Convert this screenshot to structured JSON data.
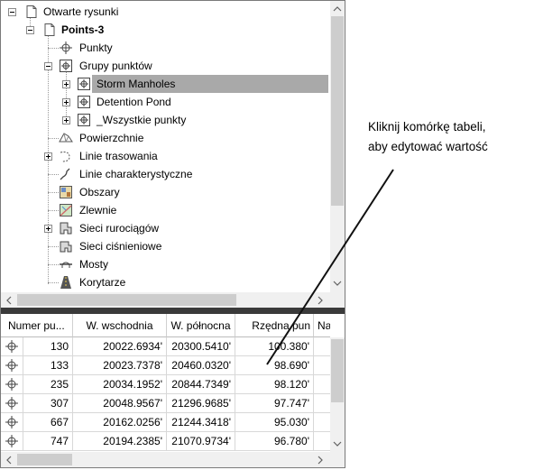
{
  "tree": {
    "root": "Otwarte rysunki",
    "drawing": "Points-3",
    "items": [
      {
        "label": "Punkty",
        "icon": "point-icon"
      },
      {
        "label": "Grupy punktów",
        "icon": "point-group-icon"
      },
      {
        "label": "Storm Manholes",
        "icon": "point-group-icon",
        "selected": true
      },
      {
        "label": "Detention Pond",
        "icon": "point-group-icon"
      },
      {
        "label": "_Wszystkie punkty",
        "icon": "point-group-icon"
      },
      {
        "label": "Powierzchnie",
        "icon": "surface-icon"
      },
      {
        "label": "Linie trasowania",
        "icon": "alignment-icon"
      },
      {
        "label": "Linie charakterystyczne",
        "icon": "feature-line-icon"
      },
      {
        "label": "Obszary",
        "icon": "site-icon"
      },
      {
        "label": "Zlewnie",
        "icon": "catchment-icon"
      },
      {
        "label": "Sieci rurociągów",
        "icon": "pipe-network-icon"
      },
      {
        "label": "Sieci ciśnieniowe",
        "icon": "pressure-network-icon"
      },
      {
        "label": "Mosty",
        "icon": "bridge-icon"
      },
      {
        "label": "Korytarze",
        "icon": "corridor-icon"
      }
    ]
  },
  "grid": {
    "columns": [
      "Numer pu...",
      "W. wschodnia",
      "W. północna",
      "Rzędna pun",
      "Na"
    ],
    "rows": [
      [
        "130",
        "20022.6934'",
        "20300.5410'",
        "100.380'"
      ],
      [
        "133",
        "20023.7378'",
        "20460.0320'",
        "98.690'"
      ],
      [
        "235",
        "20034.1952'",
        "20844.7349'",
        "98.120'"
      ],
      [
        "307",
        "20048.9567'",
        "21296.9685'",
        "97.747'"
      ],
      [
        "667",
        "20162.0256'",
        "21244.3418'",
        "95.030'"
      ],
      [
        "747",
        "20194.2385'",
        "21070.9734'",
        "96.780'"
      ]
    ]
  },
  "callout": {
    "line1": "Kliknij komórkę tabeli,",
    "line2": "aby edytować wartość"
  }
}
